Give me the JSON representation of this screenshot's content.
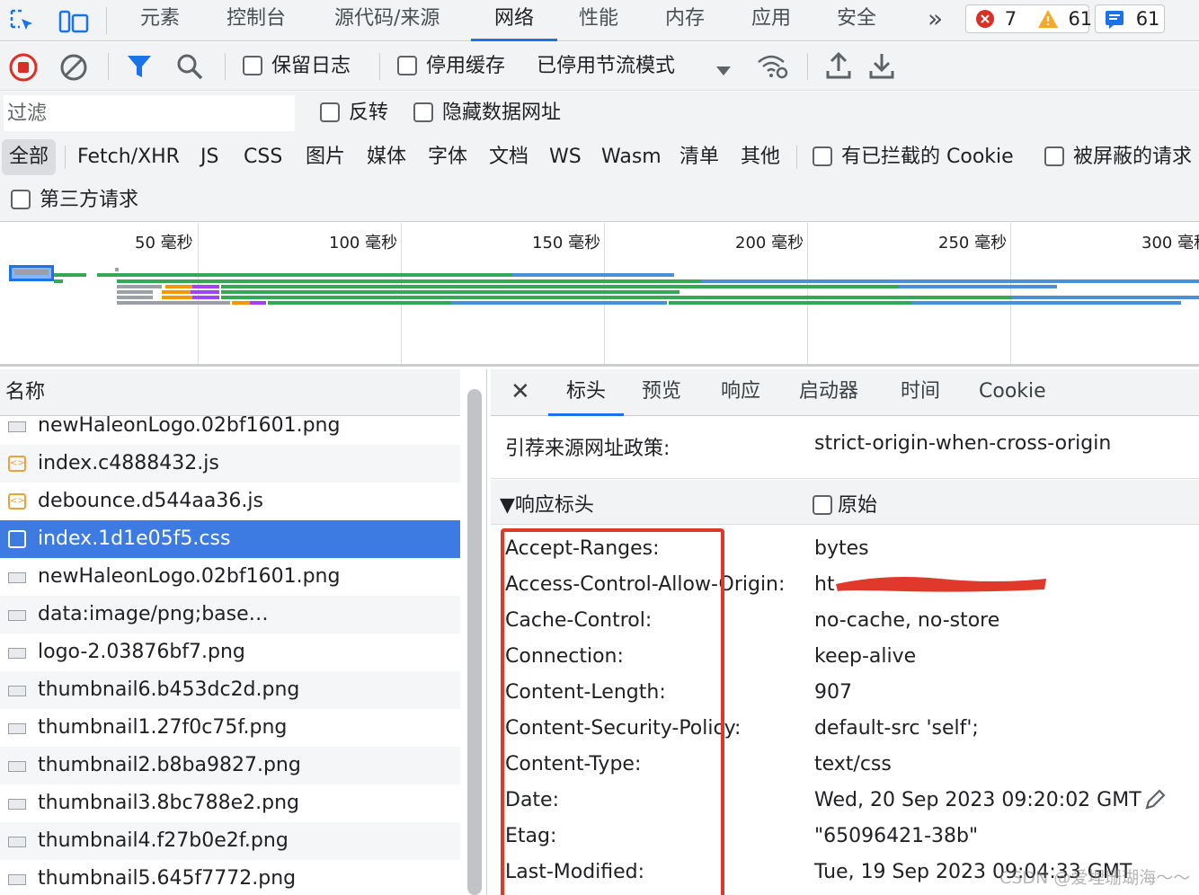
{
  "top_tabs": [
    "元素",
    "控制台",
    "源代码/来源",
    "网络",
    "性能",
    "内存",
    "应用",
    "安全"
  ],
  "top_more": "»",
  "badges": {
    "errors": "7",
    "warnings": "61",
    "messages": "61"
  },
  "toolbar": {
    "preserve_log": "保留日志",
    "disable_cache": "停用缓存",
    "throttling": "已停用节流模式"
  },
  "filter": {
    "placeholder": "过滤",
    "invert": "反转",
    "hide_data_urls": "隐藏数据网址",
    "types": [
      "全部",
      "Fetch/XHR",
      "JS",
      "CSS",
      "图片",
      "媒体",
      "字体",
      "文档",
      "WS",
      "Wasm",
      "清单",
      "其他"
    ],
    "blocked_cookies": "有已拦截的 Cookie",
    "blocked_requests": "被屏蔽的请求",
    "third_party": "第三方请求"
  },
  "timeline": {
    "ticks": [
      "50 毫秒",
      "100 毫秒",
      "150 毫秒",
      "200 毫秒",
      "250 毫秒",
      "300 毫秒"
    ]
  },
  "request_list": {
    "header": "名称",
    "rows": [
      {
        "name": "newHaleonLogo.02bf1601.png",
        "type": "img"
      },
      {
        "name": "index.c4888432.js",
        "type": "script"
      },
      {
        "name": "debounce.d544aa36.js",
        "type": "script"
      },
      {
        "name": "index.1d1e05f5.css",
        "type": "css",
        "selected": true
      },
      {
        "name": "newHaleonLogo.02bf1601.png",
        "type": "img"
      },
      {
        "name": "data:image/png;base…",
        "type": "img"
      },
      {
        "name": "logo-2.03876bf7.png",
        "type": "img"
      },
      {
        "name": "thumbnail6.b453dc2d.png",
        "type": "img"
      },
      {
        "name": "thumbnail1.27f0c75f.png",
        "type": "img"
      },
      {
        "name": "thumbnail2.b8ba9827.png",
        "type": "img"
      },
      {
        "name": "thumbnail3.8bc788e2.png",
        "type": "img"
      },
      {
        "name": "thumbnail4.f27b0e2f.png",
        "type": "img"
      },
      {
        "name": "thumbnail5.645f7772.png",
        "type": "img"
      }
    ]
  },
  "detail": {
    "close": "✕",
    "tabs": [
      "标头",
      "预览",
      "响应",
      "启动器",
      "时间",
      "Cookie"
    ],
    "referrer_policy_label": "引荐来源网址政策:",
    "referrer_policy_value": "strict-origin-when-cross-origin",
    "response_headers_title": "▼响应标头",
    "raw_label": "原始",
    "headers": [
      {
        "name": "Accept-Ranges:",
        "value": "bytes"
      },
      {
        "name": "Access-Control-Allow-Origin:",
        "value": "ht"
      },
      {
        "name": "Cache-Control:",
        "value": "no-cache, no-store"
      },
      {
        "name": "Connection:",
        "value": "keep-alive"
      },
      {
        "name": "Content-Length:",
        "value": "907"
      },
      {
        "name": "Content-Security-Policy:",
        "value": "default-src 'self';"
      },
      {
        "name": "Content-Type:",
        "value": "text/css"
      },
      {
        "name": "Date:",
        "value": "Wed, 20 Sep 2023 09:20:02 GMT"
      },
      {
        "name": "Etag:",
        "value": "\"65096421-38b\""
      },
      {
        "name": "Last-Modified:",
        "value": "Tue, 19 Sep 2023 09:04:33 GMT"
      }
    ]
  },
  "watermark": "CSDN @爱埋珊瑚海～～",
  "colors": {
    "accent": "#1a73e8",
    "selected_row": "#3d7be3",
    "annotation_red": "#e0382a"
  }
}
